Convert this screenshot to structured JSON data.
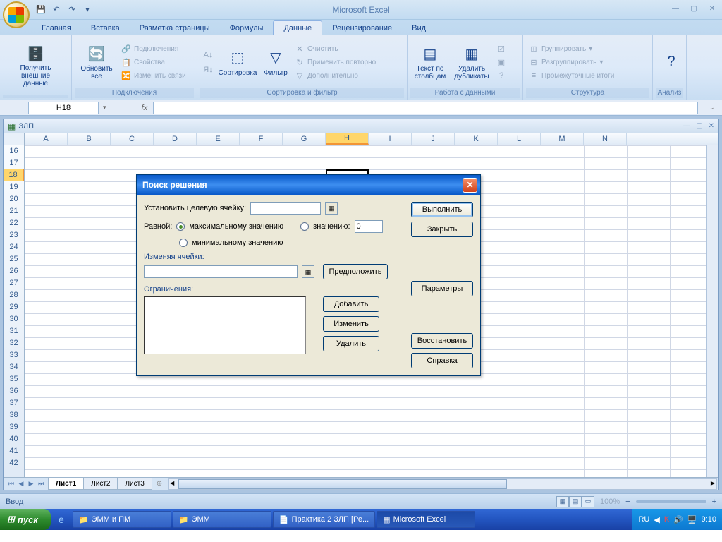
{
  "app_title": "Microsoft Excel",
  "tabs": [
    "Главная",
    "Вставка",
    "Разметка страницы",
    "Формулы",
    "Данные",
    "Рецензирование",
    "Вид"
  ],
  "active_tab_idx": 4,
  "ribbon": {
    "g1": {
      "label": "",
      "btn": "Получить\nвнешние данные"
    },
    "g2": {
      "label": "Подключения",
      "refresh": "Обновить\nвсе",
      "conns": "Подключения",
      "props": "Свойства",
      "editlinks": "Изменить связи"
    },
    "g3": {
      "label": "Сортировка и фильтр",
      "az": "А↓Я",
      "za": "Я↓А",
      "sort": "Сортировка",
      "filter": "Фильтр",
      "clear": "Очистить",
      "reapply": "Применить повторно",
      "advanced": "Дополнительно"
    },
    "g4": {
      "label": "Работа с данными",
      "t2c": "Текст по\nстолбцам",
      "dedup": "Удалить\nдубликаты"
    },
    "g5": {
      "label": "Структура",
      "group": "Группировать",
      "ungroup": "Разгруппировать",
      "subtotal": "Промежуточные итоги"
    },
    "g6": {
      "label": "Анализ"
    }
  },
  "name_box": "H18",
  "workbook_title": "ЗЛП",
  "columns": [
    "A",
    "B",
    "C",
    "D",
    "E",
    "F",
    "G",
    "H",
    "I",
    "J",
    "K",
    "L",
    "M",
    "N"
  ],
  "sel_col": "H",
  "rows": [
    16,
    17,
    18,
    19,
    20,
    21,
    22,
    23,
    24,
    25,
    26,
    27,
    28,
    29,
    30,
    31,
    32,
    33,
    34,
    35,
    36,
    37,
    38,
    39,
    40,
    41,
    42
  ],
  "sel_row": 18,
  "sheet_tabs": [
    "Лист1",
    "Лист2",
    "Лист3"
  ],
  "active_sheet": 0,
  "status": "Ввод",
  "zoom": "100%",
  "dialog": {
    "title": "Поиск решения",
    "target_label": "Установить целевую ячейку:",
    "equal_label": "Равной:",
    "opt_max": "максимальному значению",
    "opt_min": "минимальному значению",
    "opt_val": "значению:",
    "val_value": "0",
    "changing_label": "Изменяя ячейки:",
    "constraints_label": "Ограничения:",
    "btn_execute": "Выполнить",
    "btn_close": "Закрыть",
    "btn_guess": "Предположить",
    "btn_params": "Параметры",
    "btn_add": "Добавить",
    "btn_change": "Изменить",
    "btn_delete": "Удалить",
    "btn_restore": "Восстановить",
    "btn_help": "Справка"
  },
  "taskbar": {
    "start": "пуск",
    "items": [
      "ЭММ и ПМ",
      "ЭММ",
      "Практика 2 ЗЛП [Ре...",
      "Microsoft Excel"
    ],
    "active_idx": 3,
    "lang": "RU",
    "time": "9:10"
  }
}
